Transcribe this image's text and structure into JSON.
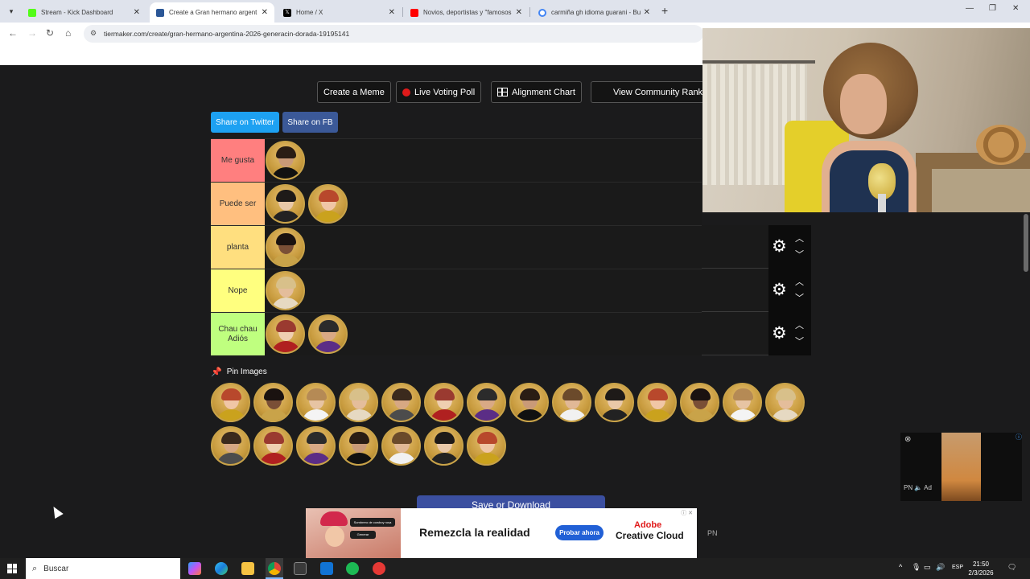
{
  "browser": {
    "tabs": [
      {
        "title": "Stream - Kick Dashboard",
        "active": false,
        "favicon_color": "#53fc18"
      },
      {
        "title": "Create a Gran hermano argent",
        "active": true,
        "favicon_color": "#2b5797"
      },
      {
        "title": "Home / X",
        "active": false,
        "favicon_color": "#000000"
      },
      {
        "title": "Novios, deportistas y \"famosos",
        "active": false,
        "favicon_color": "#ff0000"
      },
      {
        "title": "carmiña gh idioma guarani - Bu",
        "active": false,
        "favicon_color": "#4285f4"
      }
    ],
    "url": "tiermaker.com/create/gran-hermano-argentina-2026-generacin-dorada-19195141"
  },
  "toolbar": {
    "create_meme": "Create a Meme",
    "live_poll": "Live Voting Poll",
    "alignment_chart": "Alignment Chart",
    "community_rank": "View Community Rank"
  },
  "share": {
    "twitter": "Share on Twitter",
    "facebook": "Share on FB"
  },
  "tiers": [
    {
      "label": "Me gusta",
      "color": "#ff7f7f",
      "items": 1
    },
    {
      "label": "Puede ser",
      "color": "#ffbf7f",
      "items": 2
    },
    {
      "label": "planta",
      "color": "#ffdf7f",
      "items": 1
    },
    {
      "label": "Nope",
      "color": "#ffff7f",
      "items": 1
    },
    {
      "label": "Chau chau Adiós",
      "color": "#bfff7f",
      "items": 2
    }
  ],
  "pin_label": "Pin Images",
  "pool_count": 21,
  "save_label": "Save or Download",
  "ad": {
    "headline": "Remezcla la realidad",
    "cta": "Probar ahora",
    "brand_line1": "Adobe",
    "brand_line2": "Creative Cloud",
    "chip1": "Sombrero de cowboy rosa",
    "chip2": "Generar",
    "pn": "PN"
  },
  "mini_ad": {
    "label": "Ad",
    "pn": "PN"
  },
  "taskbar": {
    "search_placeholder": "Buscar",
    "lang": "ESP",
    "time": "21:50",
    "date": "2/3/2026"
  }
}
